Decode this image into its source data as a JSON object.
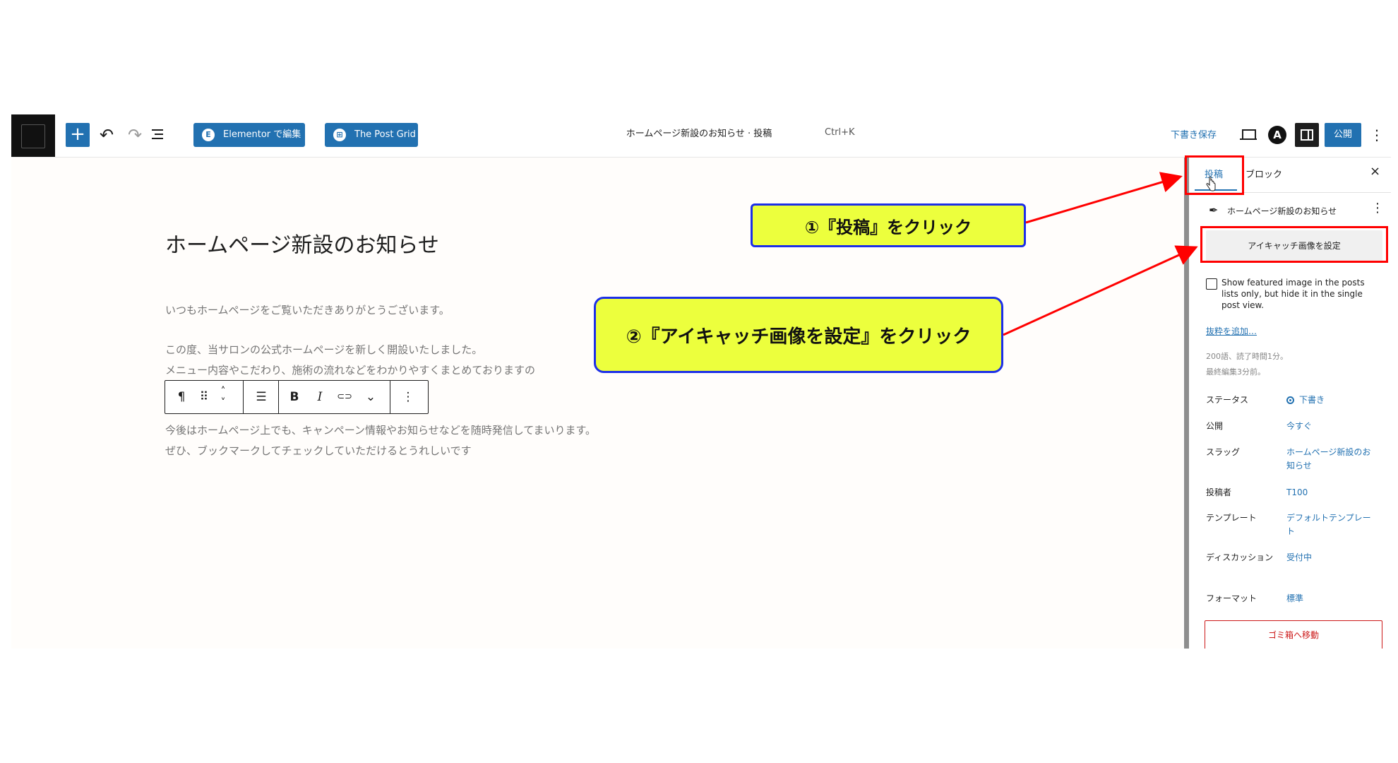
{
  "toolbar": {
    "add_label": "+",
    "undo_icon": "↶",
    "redo_icon": "↷",
    "elementor_label": "Elementor で編集",
    "elementor_icon": "E",
    "post_grid_label": "The Post Grid",
    "post_grid_icon": "⊞",
    "doc_title": "ホームページ新設のお知らせ · 投稿",
    "shortcut": "Ctrl+K",
    "save_draft": "下書き保存",
    "astra_icon": "A",
    "publish": "公開",
    "options": "⋮"
  },
  "editor": {
    "title": "ホームページ新設のお知らせ",
    "paragraphs": [
      "いつもホームページをご覧いただきありがとうございます。",
      "この度、当サロンの公式ホームページを新しく開設いたしました。",
      "メニュー内容やこだわり、施術の流れなどをわかりやすくまとめておりますの",
      "今後はホームページ上でも、キャンペーン情報やお知らせなどを随時発信してまいります。",
      "ぜひ、ブックマークしてチェックしていただけるとうれしいです"
    ],
    "block_toolbar": {
      "paragraph": "¶",
      "drag": "⠿",
      "move_up": "˄",
      "move_down": "˅",
      "align": "☰",
      "bold": "B",
      "italic": "I",
      "link": "⊂⊃",
      "more": "⌄",
      "options": "⋮"
    }
  },
  "sidebar": {
    "tab_post": "投稿",
    "tab_block": "ブロック",
    "close": "×",
    "post_icon": "✒",
    "post_name": "ホームページ新設のお知らせ",
    "post_more": "⋮",
    "featured_image_button": "アイキャッチ画像を設定",
    "show_featured_label": "Show featured image in the posts lists only, but hide it in the single post view.",
    "add_excerpt": "抜粋を追加…",
    "word_count": "200語、読了時間1分。",
    "last_edited": "最終編集3分前。",
    "rows": [
      {
        "label": "ステータス",
        "value": "下書き"
      },
      {
        "label": "公開",
        "value": "今すぐ"
      },
      {
        "label": "スラッグ",
        "value": "ホームページ新設のお知らせ"
      },
      {
        "label": "投稿者",
        "value": "T100"
      },
      {
        "label": "テンプレート",
        "value": "デフォルトテンプレート"
      },
      {
        "label": "ディスカッション",
        "value": "受付中"
      },
      {
        "label": "フォーマット",
        "value": "標準"
      }
    ],
    "trash": "ゴミ箱へ移動"
  },
  "annotations": {
    "step1": "①『投稿』をクリック",
    "step2": "②『アイキャッチ画像を設定』をクリック",
    "callout_fill": "#ecff3d",
    "callout_border": "#1c2fe8",
    "highlight_color": "#ff0000"
  },
  "colors": {
    "accent": "#2271b1",
    "danger": "#cc1818"
  }
}
